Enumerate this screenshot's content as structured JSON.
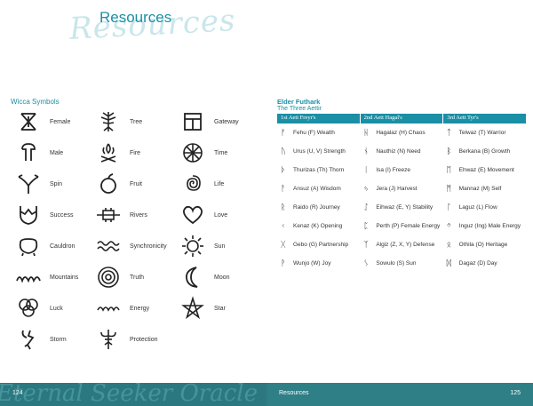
{
  "header": {
    "title": "Resources",
    "watermark": "Resources"
  },
  "wicca": {
    "title": "Wicca Symbols",
    "columns": [
      [
        {
          "icon": "female-icon",
          "label": "Female"
        },
        {
          "icon": "male-icon",
          "label": "Male"
        },
        {
          "icon": "spin-icon",
          "label": "Spin"
        },
        {
          "icon": "success-icon",
          "label": "Success"
        },
        {
          "icon": "cauldron-icon",
          "label": "Cauldron"
        },
        {
          "icon": "mountains-icon",
          "label": "Mountains"
        },
        {
          "icon": "luck-icon",
          "label": "Luck"
        },
        {
          "icon": "storm-icon",
          "label": "Storm"
        }
      ],
      [
        {
          "icon": "tree-icon",
          "label": "Tree"
        },
        {
          "icon": "fire-icon",
          "label": "Fire"
        },
        {
          "icon": "fruit-icon",
          "label": "Fruit"
        },
        {
          "icon": "rivers-icon",
          "label": "Rivers"
        },
        {
          "icon": "synchronicity-icon",
          "label": "Synchronicity"
        },
        {
          "icon": "truth-icon",
          "label": "Truth"
        },
        {
          "icon": "energy-icon",
          "label": "Energy"
        },
        {
          "icon": "protection-icon",
          "label": "Protection"
        }
      ],
      [
        {
          "icon": "gateway-icon",
          "label": "Gateway"
        },
        {
          "icon": "time-icon",
          "label": "Time"
        },
        {
          "icon": "life-icon",
          "label": "Life"
        },
        {
          "icon": "love-icon",
          "label": "Love"
        },
        {
          "icon": "sun-icon",
          "label": "Sun"
        },
        {
          "icon": "moon-icon",
          "label": "Moon"
        },
        {
          "icon": "star-icon",
          "label": "Star"
        }
      ]
    ]
  },
  "futhark": {
    "title": "Elder Futhark",
    "subtitle": "The Three Aettir",
    "headers": [
      "1st Aett Freyr's",
      "2nd Aett Hagal's",
      "3rd Aett Tyr's"
    ],
    "rows": [
      [
        {
          "rune": "ᚠ",
          "label": "Fehu (F) Wealth"
        },
        {
          "rune": "ᚺ",
          "label": "Hagalaz (H) Chaos"
        },
        {
          "rune": "ᛏ",
          "label": "Telwaz (T) Warrior"
        }
      ],
      [
        {
          "rune": "ᚢ",
          "label": "Urus (U, V) Strength"
        },
        {
          "rune": "ᚾ",
          "label": "Nauthiz (N) Need"
        },
        {
          "rune": "ᛒ",
          "label": "Berkana (B) Growth"
        }
      ],
      [
        {
          "rune": "ᚦ",
          "label": "Thurizas (Th) Thorn"
        },
        {
          "rune": "ᛁ",
          "label": "Isa (I) Freeze"
        },
        {
          "rune": "ᛖ",
          "label": "Ehwaz (E) Movement"
        }
      ],
      [
        {
          "rune": "ᚨ",
          "label": "Ansuz (A) Wisdom"
        },
        {
          "rune": "ᛃ",
          "label": "Jera (J) Harvest"
        },
        {
          "rune": "ᛗ",
          "label": "Mannaz (M) Self"
        }
      ],
      [
        {
          "rune": "ᚱ",
          "label": "Raido (R) Journey"
        },
        {
          "rune": "ᛇ",
          "label": "Eihwaz (E, Y) Stability"
        },
        {
          "rune": "ᛚ",
          "label": "Laguz (L) Flow"
        }
      ],
      [
        {
          "rune": "ᚲ",
          "label": "Kenaz (K) Opening"
        },
        {
          "rune": "ᛈ",
          "label": "Perth (P) Female Energy"
        },
        {
          "rune": "ᛜ",
          "label": "Inguz (Ing) Male Energy"
        }
      ],
      [
        {
          "rune": "ᚷ",
          "label": "Gebo (G) Partnership"
        },
        {
          "rune": "ᛉ",
          "label": "Algiz (Z, X, Y) Defense"
        },
        {
          "rune": "ᛟ",
          "label": "Othila (O) Heritage"
        }
      ],
      [
        {
          "rune": "ᚹ",
          "label": "Wunjo (W) Joy"
        },
        {
          "rune": "ᛊ",
          "label": "Sowulo (S) Sun"
        },
        {
          "rune": "ᛞ",
          "label": "Dagaz (D) Day"
        }
      ]
    ]
  },
  "footer": {
    "left_page": "124",
    "right_page": "125",
    "section": "Resources",
    "script": "Eternal Seeker Oracle"
  },
  "colors": {
    "accent": "#1a8fa5",
    "footer": "#2e7f86"
  }
}
